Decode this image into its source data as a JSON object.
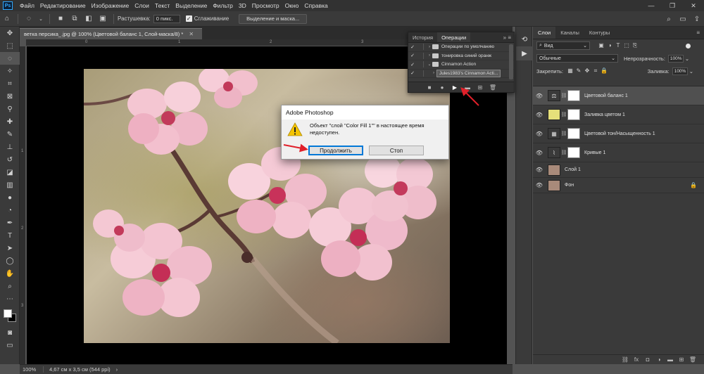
{
  "menu": {
    "logo": "Ps",
    "items": [
      "Файл",
      "Редактирование",
      "Изображение",
      "Слои",
      "Текст",
      "Выделение",
      "Фильтр",
      "3D",
      "Просмотр",
      "Окно",
      "Справка"
    ]
  },
  "options_bar": {
    "feather_label": "Растушевка:",
    "feather_value": "0 пикс.",
    "antialias_label": "Сглаживание",
    "select_mask_button": "Выделение и маска..."
  },
  "document": {
    "tab_title": "ветка персика_.jpg @ 100% (Цветовой баланс 1, Слой-маска/8) *",
    "ruler_top": [
      "0",
      "1",
      "2",
      "3",
      "4"
    ],
    "ruler_left": [
      "1",
      "2",
      "3"
    ]
  },
  "status": {
    "zoom": "100%",
    "doc_size": "4,67 см x 3,5 см (544 ppi)"
  },
  "actions_panel": {
    "tabs": [
      "История",
      "Операции"
    ],
    "active_tab": "Операции",
    "rows": [
      {
        "label": "Операции по умолчанию",
        "type": "folder",
        "checked": true
      },
      {
        "label": "тонировка синий оранж",
        "type": "folder",
        "checked": true
      },
      {
        "label": "Cinnamon Action",
        "type": "folder",
        "checked": true,
        "expanded": true
      },
      {
        "label": "Jules1983's Cinnamon Acti...",
        "type": "action",
        "checked": true,
        "selected": true
      }
    ]
  },
  "layers_panel": {
    "tabs": [
      "Слои",
      "Каналы",
      "Контуры"
    ],
    "active_tab": "Слои",
    "filter_label": "Вид",
    "blend_mode": "Обычные",
    "opacity_label": "Непрозрачность:",
    "opacity_value": "100%",
    "lock_label": "Закрепить:",
    "fill_label": "Заливка:",
    "fill_value": "100%",
    "layers": [
      {
        "name": "Цветовой баланс 1",
        "thumb_color": "#3a3a3a",
        "thumb_glyph": "⚖",
        "has_mask": true,
        "selected": true
      },
      {
        "name": "Заливка цветом 1",
        "thumb_color": "#e6e07a",
        "thumb_glyph": "",
        "has_mask": true,
        "selected": false
      },
      {
        "name": "Цветовой тон/Насыщенность 1",
        "thumb_color": "#3a3a3a",
        "thumb_glyph": "▦",
        "has_mask": true,
        "selected": false
      },
      {
        "name": "Кривые 1",
        "thumb_color": "#3a3a3a",
        "thumb_glyph": "⌇",
        "has_mask": true,
        "selected": false
      },
      {
        "name": "Слой 1",
        "thumb_color": "#a88a7a",
        "thumb_glyph": "",
        "has_mask": false,
        "selected": false
      },
      {
        "name": "Фон",
        "thumb_color": "#a88a7a",
        "thumb_glyph": "",
        "has_mask": false,
        "selected": false,
        "locked": true
      }
    ]
  },
  "dialog": {
    "title": "Adobe Photoshop",
    "message": "Объект \"слой \"Color Fill 1\"\" в настоящее время недоступен.",
    "continue_button": "Продолжить",
    "stop_button": "Стоп"
  },
  "colors": {
    "accent_blue": "#0078d7",
    "annotation_red": "#e0202a",
    "ps_blue": "#31a8ff"
  }
}
